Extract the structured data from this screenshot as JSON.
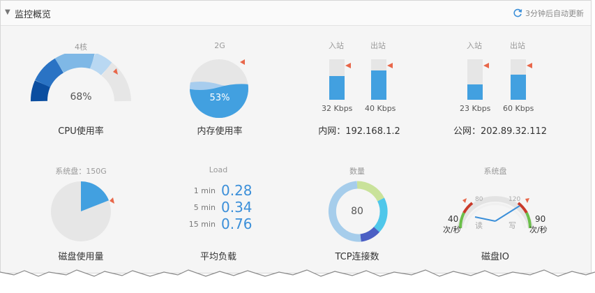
{
  "header": {
    "title": "监控概览",
    "refresh_text": "3分钟后自动更新"
  },
  "cpu": {
    "top": "4核",
    "value": "68%",
    "label": "CPU使用率",
    "percent": 68
  },
  "mem": {
    "top": "2G",
    "value": "53%",
    "label": "内存使用率",
    "percent": 53
  },
  "net_in": {
    "in_label": "入站",
    "out_label": "出站",
    "in_value": "32 Kbps",
    "out_value": "40 Kbps",
    "in_level": 0.58,
    "out_level": 0.72,
    "label": "内网：192.168.1.2"
  },
  "net_pub": {
    "in_label": "入站",
    "out_label": "出站",
    "in_value": "23 Kbps",
    "out_value": "60 Kbps",
    "in_level": 0.38,
    "out_level": 0.62,
    "label": "公网：202.89.32.112"
  },
  "disk": {
    "top": "系统盘：150G",
    "label": "磁盘使用量",
    "fraction": 0.19
  },
  "load": {
    "top": "Load",
    "rows": [
      {
        "name": "1 min",
        "value": "0.28"
      },
      {
        "name": "5 min",
        "value": "0.34"
      },
      {
        "name": "15 min",
        "value": "0.76"
      }
    ],
    "label": "平均负载"
  },
  "tcp": {
    "top": "数量",
    "value": "80",
    "label": "TCP连接数"
  },
  "io": {
    "top": "系统盘",
    "read_value": "40",
    "write_value": "90",
    "unit": "次/秒",
    "read_label": "读",
    "write_label": "写",
    "label": "磁盘IO",
    "ticks": [
      "80",
      "120"
    ]
  },
  "colors": {
    "accent": "#42a0e0",
    "marker": "#e8674a"
  }
}
